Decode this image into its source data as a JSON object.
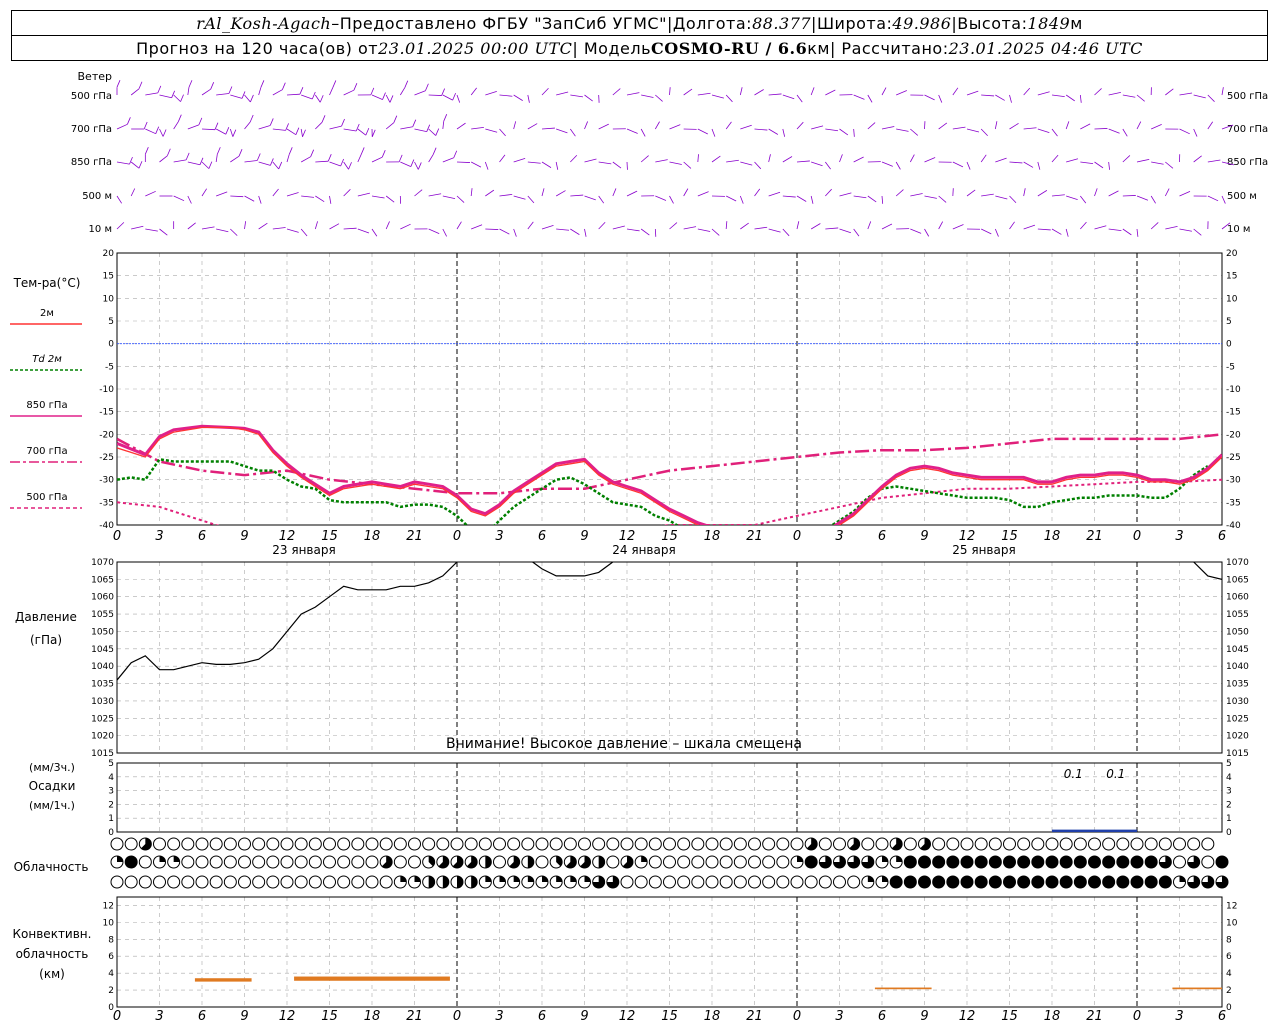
{
  "header": {
    "station": "rAl_Kosh-Agach",
    "dash": " – ",
    "provider": "Предоставлено ФГБУ \"ЗапСиб УГМС\"",
    "sep": " | ",
    "lon_label": "Долгота: ",
    "lon": "88.377",
    "lat_label": "Широта: ",
    "lat": "49.986",
    "alt_label": "Высота: ",
    "alt": "1849",
    "alt_unit": "м",
    "forecast_prefix": "Прогноз на 120 часа(ов) от ",
    "forecast_start": "23.01.2025 00:00 UTC",
    "model_label": "  | Модель ",
    "model": "COSMO-RU / 6.6",
    "model_unit": "км",
    "calc_label": " | Рассчитано: ",
    "calc_time": "23.01.2025 04:46 UTC"
  },
  "colors": {
    "t2m": "#ff3333",
    "td2m": "#008000",
    "t850": "#e0208a",
    "t700": "#e0207a",
    "t500": "#e0207a",
    "zero_line": "#3355ff",
    "wind": "#8800cc",
    "pressure": "#000000",
    "precip": "#1f3faa",
    "convective": "#e07a20",
    "grid": "#aaaaaa"
  },
  "wind_panel": {
    "title": "Ветер",
    "levels": [
      "500 гПа",
      "700 гПа",
      "850 гПа",
      "500 м",
      "10 м"
    ]
  },
  "temp_panel": {
    "title": "Тем-ра(°C)",
    "legend": [
      {
        "label": "2м",
        "style": "solid",
        "color": "#ff3333"
      },
      {
        "label": "Td 2м",
        "style": "dotted",
        "color": "#008000"
      },
      {
        "label": "850 гПа",
        "style": "solid-thick",
        "color": "#e0208a"
      },
      {
        "label": "700 гПа",
        "style": "dashdot",
        "color": "#e0207a"
      },
      {
        "label": "500 гПа",
        "style": "dashed",
        "color": "#e0207a"
      }
    ],
    "ticks": [
      "20",
      "15",
      "10",
      "5",
      "0",
      "-5",
      "-10",
      "-15",
      "-20",
      "-25",
      "-30",
      "-35",
      "-40"
    ]
  },
  "pressure_panel": {
    "title": "Давление",
    "unit": "(гПа)",
    "warning": "Внимание! Высокое давление – шкала смещена",
    "ticks": [
      "1070",
      "1065",
      "1060",
      "1055",
      "1050",
      "1045",
      "1040",
      "1035",
      "1030",
      "1025",
      "1020",
      "1015"
    ]
  },
  "precip_panel": {
    "unit3": "(мм/3ч.)",
    "title": "Осадки",
    "unit1": "(мм/1ч.)",
    "ticks": [
      "5",
      "4",
      "3",
      "2",
      "1",
      "0"
    ],
    "labels": [
      "0.1",
      "0.1"
    ]
  },
  "cloud_panel": {
    "title": "Облачность"
  },
  "conv_panel": {
    "title1": "Конвективн.",
    "title2": "облачность",
    "unit": "(км)",
    "ticks": [
      "12",
      "10",
      "8",
      "6",
      "4",
      "2",
      "0"
    ]
  },
  "time_axis": {
    "hour_labels": [
      "0",
      "3",
      "6",
      "9",
      "12",
      "15",
      "18",
      "21",
      "0",
      "3",
      "6",
      "9",
      "12",
      "15",
      "18",
      "21",
      "0",
      "3",
      "6",
      "9",
      "12",
      "15",
      "18",
      "21",
      "0",
      "3",
      "6"
    ],
    "day_labels": [
      "23 января",
      "24 января",
      "25 января"
    ]
  },
  "chart_data": {
    "type": "line",
    "x_unit": "hours from 23.01.2025 00:00 UTC",
    "x_range": [
      0,
      78
    ],
    "temperature": {
      "ylim": [
        -40,
        20
      ],
      "series": [
        {
          "name": "2м",
          "x": [
            0,
            2,
            3,
            4,
            6,
            8,
            9,
            10,
            11,
            12,
            13,
            14,
            15,
            16,
            18,
            19,
            20,
            21,
            22,
            23,
            24,
            25,
            26,
            27,
            28,
            29,
            30,
            31,
            32,
            33,
            34,
            35,
            36,
            37,
            38,
            39,
            40,
            41,
            42,
            43,
            44,
            45,
            46,
            47,
            48,
            49,
            50,
            51,
            52,
            53,
            54,
            55,
            56,
            57,
            58,
            59,
            60,
            61,
            62,
            63,
            64,
            65,
            66,
            67,
            68,
            69,
            70,
            71,
            72,
            73,
            74,
            75,
            76,
            77,
            78
          ],
          "values": [
            -23,
            -25,
            -21,
            -19.5,
            -18.5,
            -18.5,
            -19,
            -20,
            -24,
            -27,
            -29.5,
            -31.5,
            -33.5,
            -32,
            -31,
            -31.5,
            -32,
            -31,
            -31.5,
            -32,
            -34,
            -37,
            -38,
            -36,
            -33,
            -31,
            -29,
            -27,
            -26.5,
            -26,
            -29,
            -31,
            -32,
            -33,
            -35,
            -37,
            -38.5,
            -40,
            -41,
            -42,
            -43,
            -44,
            -42,
            -41,
            -41,
            -41,
            -42,
            -40,
            -38,
            -35,
            -32,
            -29.5,
            -28,
            -27.5,
            -28,
            -29,
            -29.5,
            -30,
            -30,
            -30,
            -30,
            -31,
            -31,
            -30,
            -29.5,
            -29.5,
            -29,
            -29,
            -29.5,
            -30.5,
            -30.5,
            -31,
            -30,
            -28,
            -25
          ]
        },
        {
          "name": "Td 2м",
          "x": [
            0,
            1,
            2,
            3,
            4,
            6,
            8,
            9,
            10,
            11,
            12,
            13,
            14,
            15,
            16,
            18,
            19,
            20,
            21,
            22,
            23,
            24,
            25,
            26,
            27,
            28,
            29,
            30,
            31,
            32,
            33,
            34,
            35,
            36,
            37,
            38,
            39,
            40,
            41,
            42,
            43,
            44,
            45,
            46,
            47,
            48,
            49,
            50,
            51,
            52,
            53,
            54,
            55,
            56,
            57,
            58,
            59,
            60,
            61,
            62,
            63,
            64,
            65,
            66,
            67,
            68,
            69,
            70,
            71,
            72,
            73,
            74,
            75,
            76,
            77,
            78
          ],
          "values": [
            -30,
            -29.5,
            -30,
            -25.5,
            -26,
            -26,
            -26,
            -27,
            -28,
            -28,
            -30,
            -31.5,
            -32,
            -34.5,
            -35,
            -35,
            -35,
            -36,
            -35.5,
            -35.5,
            -36,
            -38,
            -41,
            -42,
            -39,
            -36,
            -34,
            -32,
            -30,
            -29.5,
            -31,
            -33,
            -35,
            -35.5,
            -36,
            -38,
            -39,
            -41,
            -42,
            -43,
            -44,
            -45,
            -43,
            -42,
            -42,
            -43,
            -43,
            -41,
            -39,
            -37,
            -34,
            -32,
            -31.5,
            -32,
            -32.5,
            -33,
            -33.5,
            -34,
            -34,
            -34,
            -34.5,
            -36,
            -36,
            -35,
            -34.5,
            -34,
            -34,
            -33.5,
            -33.5,
            -33.5,
            -34,
            -34,
            -32,
            -29,
            -27
          ]
        },
        {
          "name": "850 гПа",
          "x": [
            0,
            2,
            3,
            4,
            6,
            8,
            9,
            10,
            11,
            12,
            13,
            14,
            15,
            16,
            18,
            19,
            20,
            21,
            22,
            23,
            24,
            25,
            26,
            27,
            28,
            29,
            30,
            31,
            32,
            33,
            34,
            35,
            36,
            37,
            38,
            39,
            40,
            41,
            42,
            43,
            44,
            45,
            46,
            47,
            48,
            49,
            50,
            51,
            52,
            53,
            54,
            55,
            56,
            57,
            58,
            59,
            60,
            61,
            62,
            63,
            64,
            65,
            66,
            67,
            68,
            69,
            70,
            71,
            72,
            73,
            74,
            75,
            76,
            77,
            78
          ],
          "values": [
            -22,
            -24.5,
            -20.5,
            -19,
            -18.2,
            -18.5,
            -18.7,
            -19.5,
            -23.5,
            -26.5,
            -29,
            -31,
            -33,
            -31.5,
            -30.5,
            -31,
            -31.5,
            -30.5,
            -31,
            -31.5,
            -33.5,
            -36.5,
            -37.5,
            -35.5,
            -32.5,
            -30.5,
            -28.5,
            -26.5,
            -26,
            -25.5,
            -28.5,
            -30.5,
            -31.5,
            -32.5,
            -34.5,
            -36.5,
            -38,
            -39.5,
            -40.5,
            -41.5,
            -42.5,
            -43.5,
            -41.5,
            -40.5,
            -40.5,
            -40.5,
            -41.5,
            -39.5,
            -37.5,
            -34.5,
            -31.5,
            -29,
            -27.5,
            -27,
            -27.5,
            -28.5,
            -29,
            -29.5,
            -29.5,
            -29.5,
            -29.5,
            -30.5,
            -30.5,
            -29.5,
            -29,
            -29,
            -28.5,
            -28.5,
            -29,
            -30,
            -30,
            -30.5,
            -29.5,
            -27.5,
            -24.5
          ]
        },
        {
          "name": "700 гПа",
          "x": [
            0,
            3,
            6,
            9,
            12,
            15,
            18,
            21,
            24,
            27,
            30,
            33,
            36,
            39,
            42,
            45,
            48,
            51,
            54,
            57,
            60,
            63,
            66,
            69,
            72,
            75,
            78
          ],
          "values": [
            -21,
            -26,
            -28,
            -29,
            -28,
            -30,
            -31,
            -32,
            -33,
            -33,
            -32,
            -32,
            -30,
            -28,
            -27,
            -26,
            -25,
            -24,
            -23.5,
            -23.5,
            -23,
            -22,
            -21,
            -21,
            -21,
            -21,
            -20
          ]
        },
        {
          "name": "500 гПа",
          "x": [
            0,
            3,
            6,
            9,
            12,
            15,
            18,
            21,
            24,
            27,
            30,
            33,
            36,
            39,
            42,
            45,
            48,
            51,
            54,
            57,
            60,
            63,
            66,
            69,
            72,
            75,
            78
          ],
          "values": [
            -35,
            -36,
            -39,
            -42,
            -45,
            -47,
            -46,
            -44,
            -44,
            -44,
            -44,
            -43,
            -41,
            -40,
            -40,
            -40,
            -38,
            -36,
            -34,
            -33,
            -32,
            -32,
            -31.5,
            -31,
            -30.5,
            -30.5,
            -30
          ]
        }
      ]
    },
    "pressure": {
      "ylim": [
        1015,
        1070
      ],
      "x": [
        0,
        1,
        2,
        3,
        4,
        5,
        6,
        7,
        8,
        9,
        10,
        11,
        12,
        13,
        14,
        15,
        16,
        17,
        18,
        19,
        20,
        21,
        22,
        23,
        24,
        25,
        26,
        27,
        28,
        29,
        30,
        31,
        32,
        33,
        34,
        35,
        36,
        37,
        76,
        77,
        78
      ],
      "values": [
        1036,
        1041,
        1043,
        1039,
        1039,
        1040,
        1041,
        1040.5,
        1040.5,
        1041,
        1042,
        1045,
        1050,
        1055,
        1057,
        1060,
        1063,
        1062,
        1062,
        1062,
        1063,
        1063,
        1064,
        1066,
        1070,
        1072,
        1074,
        1075,
        1074,
        1071,
        1068,
        1066,
        1066,
        1066,
        1067,
        1070,
        1073,
        1075,
        1070,
        1066,
        1065
      ]
    },
    "precipitation": {
      "ylim": [
        0,
        5
      ],
      "labels": [
        {
          "x": 67.5,
          "text": "0.1"
        },
        {
          "x": 70.5,
          "text": "0.1"
        }
      ],
      "bars": [
        {
          "x_start": 66,
          "x_end": 72,
          "value": 0.1
        }
      ]
    },
    "cloudiness": {
      "rows": 3,
      "x_step_hours": 1,
      "oktas": [
        [
          0,
          0,
          5,
          0,
          0,
          0,
          0,
          0,
          0,
          0,
          0,
          0,
          0,
          0,
          0,
          0,
          0,
          0,
          0,
          0,
          0,
          0,
          0,
          0,
          0,
          0,
          0,
          0,
          0,
          0,
          0,
          0,
          0,
          0,
          0,
          0,
          0,
          0,
          0,
          0,
          0,
          0,
          0,
          0,
          0,
          0,
          0,
          0,
          0,
          5,
          0,
          0,
          5,
          0,
          0,
          5,
          0,
          5,
          0,
          0,
          0,
          0,
          0,
          0,
          0,
          0,
          0,
          0,
          0,
          0,
          0,
          0,
          0,
          0,
          0,
          0,
          0,
          0
        ],
        [
          2,
          8,
          0,
          2,
          2,
          0,
          0,
          0,
          0,
          0,
          0,
          0,
          0,
          0,
          0,
          0,
          0,
          0,
          0,
          5,
          0,
          0,
          3,
          5,
          5,
          5,
          4,
          0,
          5,
          4,
          0,
          3,
          5,
          5,
          4,
          0,
          5,
          2,
          0,
          0,
          0,
          0,
          0,
          0,
          0,
          0,
          0,
          0,
          2,
          8,
          6,
          6,
          6,
          6,
          2,
          2,
          8,
          8,
          8,
          8,
          8,
          8,
          8,
          8,
          8,
          8,
          8,
          8,
          8,
          8,
          8,
          8,
          8,
          8,
          6,
          0,
          6,
          0,
          8,
          8,
          8
        ],
        [
          0,
          0,
          0,
          0,
          0,
          0,
          0,
          0,
          0,
          0,
          0,
          0,
          0,
          0,
          0,
          0,
          0,
          0,
          0,
          0,
          2,
          2,
          4,
          4,
          4,
          4,
          2,
          2,
          2,
          2,
          2,
          2,
          2,
          2,
          6,
          6,
          0,
          0,
          0,
          0,
          0,
          0,
          0,
          0,
          0,
          0,
          0,
          0,
          0,
          0,
          0,
          0,
          0,
          2,
          2,
          8,
          8,
          8,
          8,
          8,
          8,
          8,
          8,
          8,
          8,
          8,
          8,
          8,
          8,
          8,
          8,
          8,
          8,
          8,
          8,
          2,
          6,
          6,
          6,
          8
        ]
      ]
    },
    "convective": {
      "ylim": [
        0,
        13
      ],
      "segments": [
        {
          "x_start": 5.5,
          "x_end": 9.5,
          "bottom": 3,
          "top": 3.4
        },
        {
          "x_start": 12.5,
          "x_end": 23.5,
          "bottom": 3.1,
          "top": 3.6
        },
        {
          "x_start": 53.5,
          "x_end": 57.5,
          "bottom": 2.1,
          "top": 2.3
        },
        {
          "x_start": 74.5,
          "x_end": 78,
          "bottom": 2.1,
          "top": 2.3
        }
      ]
    }
  }
}
